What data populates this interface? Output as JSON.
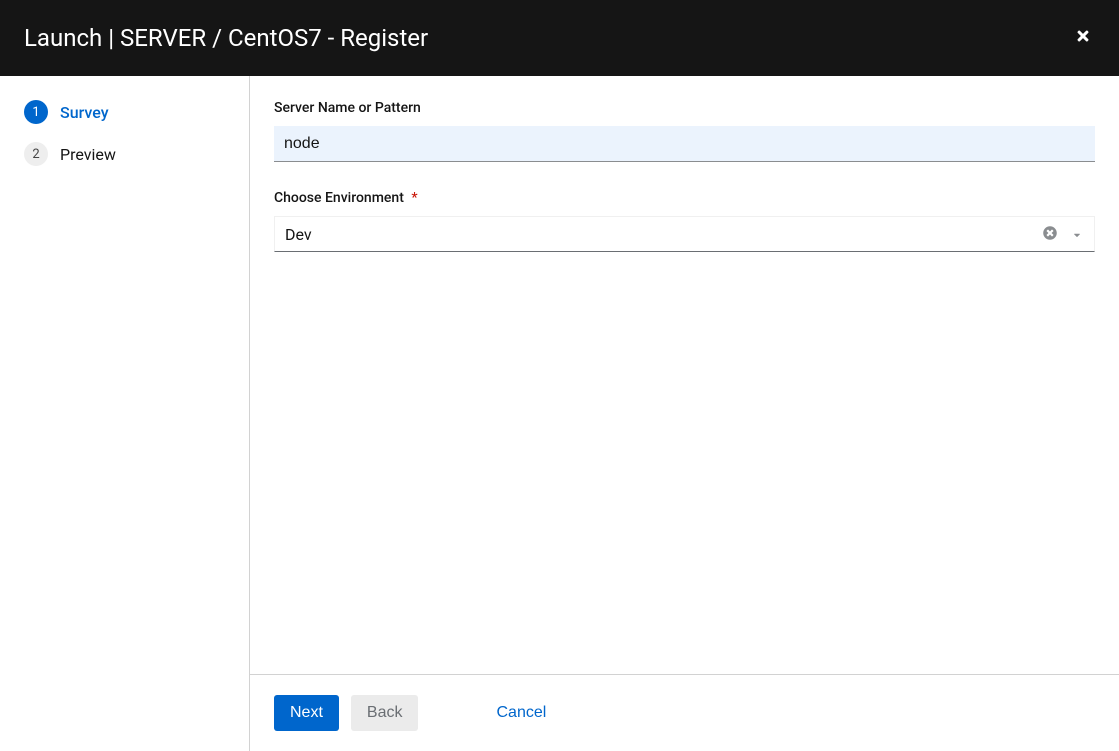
{
  "header": {
    "title": "Launch | SERVER / CentOS7 - Register"
  },
  "sidebar": {
    "steps": [
      {
        "num": "1",
        "label": "Survey"
      },
      {
        "num": "2",
        "label": "Preview"
      }
    ]
  },
  "form": {
    "server_name_label": "Server Name or Pattern",
    "server_name_value": "node",
    "env_label": "Choose Environment",
    "env_required": "*",
    "env_value": "Dev"
  },
  "footer": {
    "next": "Next",
    "back": "Back",
    "cancel": "Cancel"
  }
}
